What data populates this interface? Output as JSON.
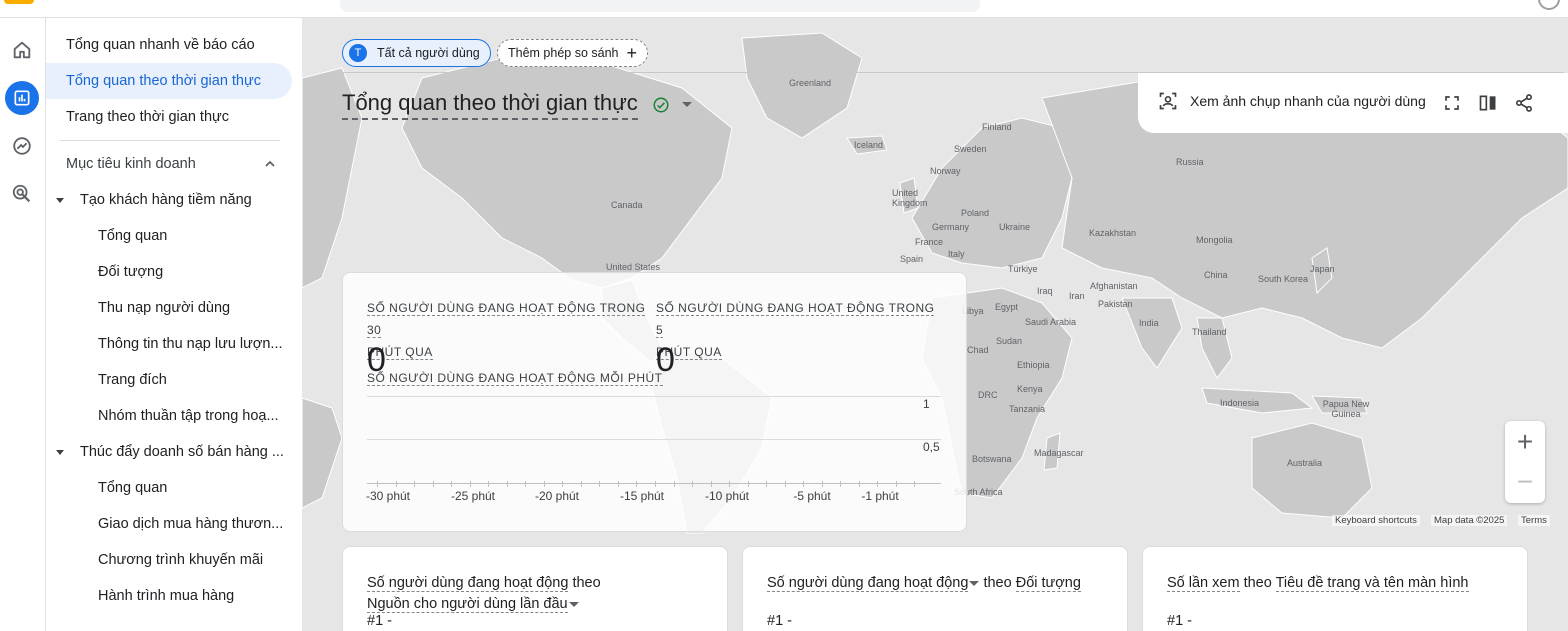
{
  "nav": {
    "top_items": [
      "Tổng quan nhanh về báo cáo",
      "Tổng quan theo thời gian thực",
      "Trang theo thời gian thực"
    ],
    "section_title": "Mục tiêu kinh doanh",
    "group1": {
      "label": "Tạo khách hàng tiềm năng",
      "children": [
        "Tổng quan",
        "Đối tượng",
        "Thu nạp người dùng",
        "Thông tin thu nạp lưu lượn...",
        "Trang đích",
        "Nhóm thuần tập trong hoạ..."
      ]
    },
    "group2": {
      "label": "Thúc đẩy doanh số bán hàng ...",
      "children": [
        "Tổng quan",
        "Giao dịch mua hàng thươn...",
        "Chương trình khuyến mãi",
        "Hành trình mua hàng"
      ]
    }
  },
  "chips": {
    "all_users_badge": "T",
    "all_users": "Tất cả người dùng",
    "add_compare": "Thêm phép so sánh",
    "add_compare_icon": "+"
  },
  "page": {
    "title": "Tổng quan theo thời gian thực"
  },
  "actions": {
    "snapshot": "Xem ảnh chụp nhanh của người dùng"
  },
  "realtime": {
    "metric1_line1": "SỐ NGƯỜI DÙNG ĐANG HOẠT ĐỘNG TRONG 30",
    "metric1_line2": "PHÚT QUA",
    "metric1_value": "0",
    "metric2_line1": "SỐ NGƯỜI DÙNG ĐANG HOẠT ĐỘNG TRONG 5",
    "metric2_line2": "PHÚT QUA",
    "metric2_value": "0",
    "per_minute_label": "SỐ NGƯỜI DÙNG ĐANG HOẠT ĐỘNG MỖI PHÚT"
  },
  "chart_data": {
    "type": "bar",
    "categories": [
      "-30 phút",
      "-25 phút",
      "-20 phút",
      "-15 phút",
      "-10 phút",
      "-5 phút",
      "-1 phút"
    ],
    "y_ticks": [
      "1",
      "0,5"
    ],
    "ylim": [
      0,
      1
    ],
    "values": [
      0,
      0,
      0,
      0,
      0,
      0,
      0,
      0,
      0,
      0,
      0,
      0,
      0,
      0,
      0,
      0,
      0,
      0,
      0,
      0,
      0,
      0,
      0,
      0,
      0,
      0,
      0,
      0,
      0,
      0
    ],
    "grid": true
  },
  "map": {
    "labels": [
      "Greenland",
      "Finland",
      "Sweden",
      "Iceland",
      "Norway",
      "Russia",
      "United Kingdom",
      "Poland",
      "Germany",
      "Ukraine",
      "Kazakhstan",
      "Mongolia",
      "France",
      "Italy",
      "Spain",
      "Canada",
      "Türkiye",
      "Afghanistan",
      "China",
      "Japan",
      "South Korea",
      "Iraq",
      "Iran",
      "Pakistan",
      "Egypt",
      "Saudi Arabia",
      "India",
      "Thailand",
      "Chad",
      "Sudan",
      "Ethiopia",
      "Kenya",
      "DRC",
      "Tanzania",
      "Madagascar",
      "Botswana",
      "South Africa",
      "Indonesia",
      "Papua New Guinea",
      "Australia",
      "United States",
      "Libya"
    ],
    "zoom_in": "+",
    "zoom_out": "−",
    "footer_shortcuts": "Keyboard shortcuts",
    "footer_data": "Map data ©2025",
    "footer_terms": "Terms"
  },
  "cards": [
    {
      "title_a": "Số người dùng đang hoạt động",
      "title_b": " theo ",
      "title_c": "Nguồn cho người dùng lần đầu",
      "rank": "#1  -"
    },
    {
      "title_a": "Số người dùng đang hoạt động",
      "title_b": " theo ",
      "title_c": "Đối tượng",
      "rank": "#1  -"
    },
    {
      "title_a": "Số lần xem",
      "title_b": " theo ",
      "title_c": "Tiêu đề trang và tên màn hình",
      "rank": "#1  -"
    }
  ],
  "colors": {
    "accent": "#1a73e8",
    "selected_bg": "#e8f0fe",
    "map_bg": "#e6e6e6",
    "land": "#c9c9c9",
    "check": "#188038"
  }
}
